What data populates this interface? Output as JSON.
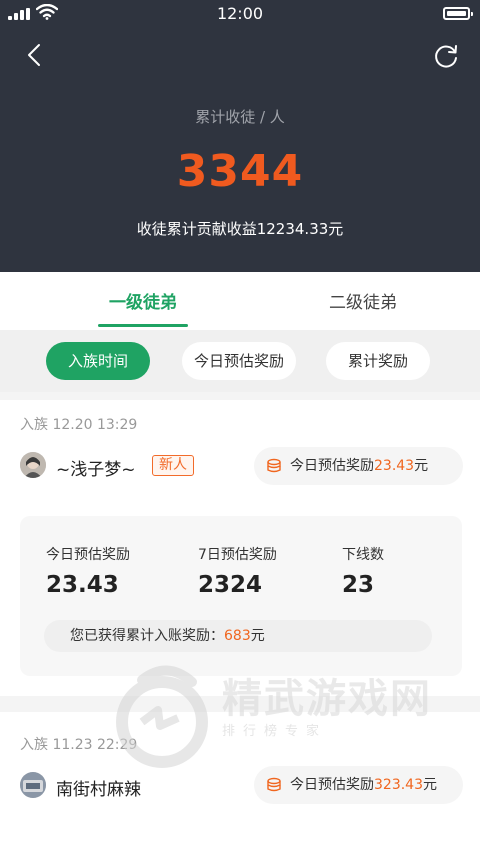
{
  "status_bar": {
    "time": "12:00"
  },
  "header": {
    "total_label": "累计收徒 / 人",
    "total_count": "3344",
    "contribution": "收徒累计贡献收益12234.33元"
  },
  "tabs": [
    {
      "label": "一级徒弟",
      "active": true
    },
    {
      "label": "二级徒弟",
      "active": false
    }
  ],
  "filters": [
    {
      "label": "入族时间",
      "active": true
    },
    {
      "label": "今日预估奖励",
      "active": false
    },
    {
      "label": "累计奖励",
      "active": false
    }
  ],
  "apprentices": [
    {
      "join_time": "入族 12.20 13:29",
      "name": "~浅子梦~",
      "badge": "新人",
      "reward_prefix": "今日预估奖励",
      "reward_value": "23.43",
      "reward_suffix": "元",
      "stats": [
        {
          "label": "今日预估奖励",
          "value": "23.43"
        },
        {
          "label": "7日预估奖励",
          "value": "2324"
        },
        {
          "label": "下线数",
          "value": "23"
        }
      ],
      "accum_prefix": "您已获得累计入账奖励：",
      "accum_value": "683",
      "accum_suffix": "元"
    },
    {
      "join_time": "入族 11.23 22:29",
      "name": "南街村麻辣",
      "reward_prefix": "今日预估奖励",
      "reward_value": "323.43",
      "reward_suffix": "元"
    }
  ],
  "watermark": {
    "title": "精武游戏网",
    "subtitle": "排行榜专家"
  },
  "colors": {
    "header_bg": "#2f343f",
    "accent_green": "#1fa363",
    "accent_orange": "#f05a1f"
  }
}
